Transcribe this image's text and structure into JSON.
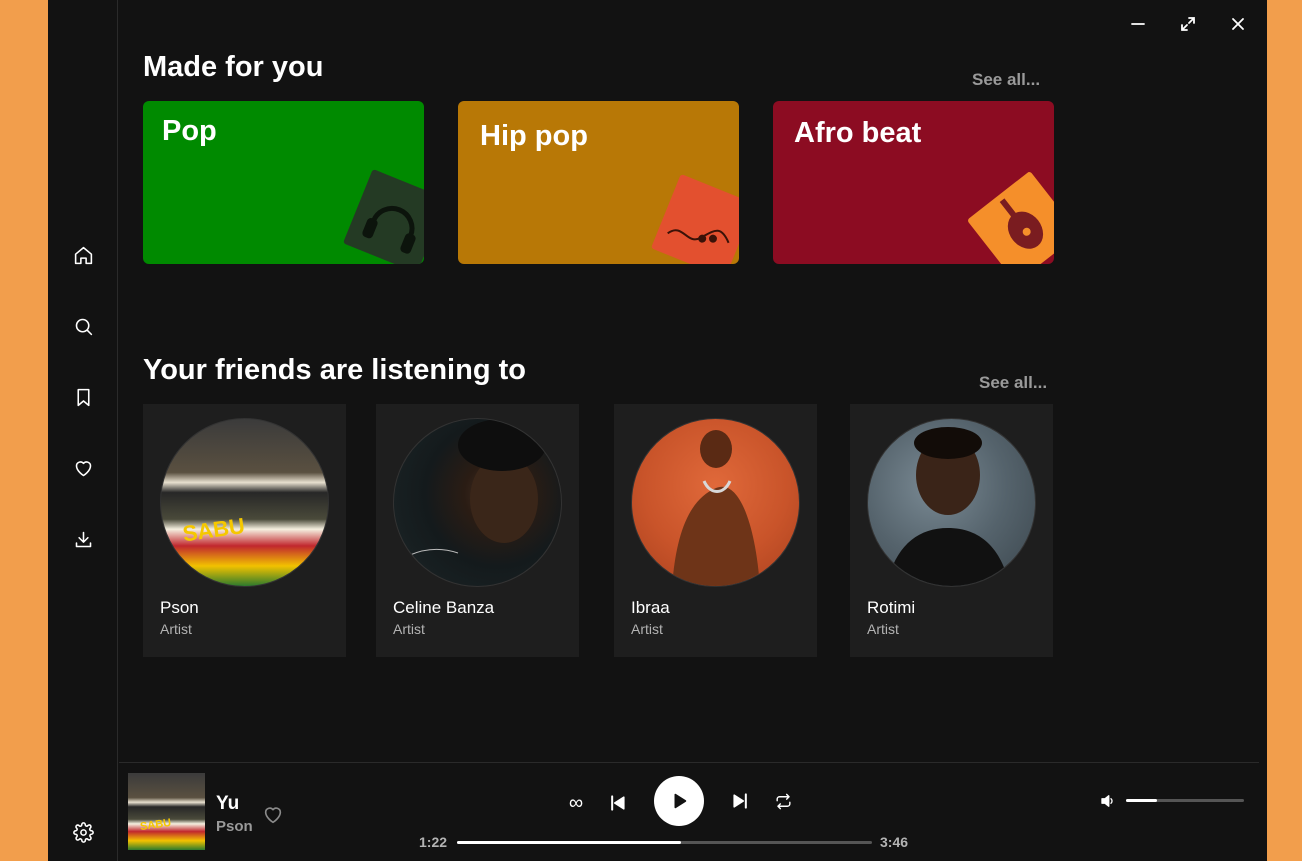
{
  "made_for_you": {
    "title": "Made for you",
    "see_all": "See all...",
    "genres": [
      {
        "label": "Pop",
        "color": "#008A00"
      },
      {
        "label": "Hip pop",
        "color": "#B87806"
      },
      {
        "label": "Afro beat",
        "color": "#8C0C22"
      }
    ]
  },
  "friends": {
    "title": "Your friends are listening to",
    "see_all": "See all...",
    "items": [
      {
        "name": "Pson",
        "role": "Artist"
      },
      {
        "name": "Celine Banza",
        "role": "Artist"
      },
      {
        "name": "Ibraa",
        "role": "Artist"
      },
      {
        "name": "Rotimi",
        "role": "Artist"
      }
    ]
  },
  "now_playing": {
    "title": "Yu",
    "artist": "Pson",
    "elapsed": "1:22",
    "duration": "3:46",
    "progress": 0.54,
    "volume": 0.26
  },
  "sidebar": {
    "icons": [
      "home-icon",
      "search-icon",
      "bookmark-icon",
      "heart-icon",
      "download-icon",
      "gear-icon"
    ]
  },
  "colors": {
    "background": "#121212",
    "frame": "#F29E4C",
    "card": "#1e1e1e"
  }
}
